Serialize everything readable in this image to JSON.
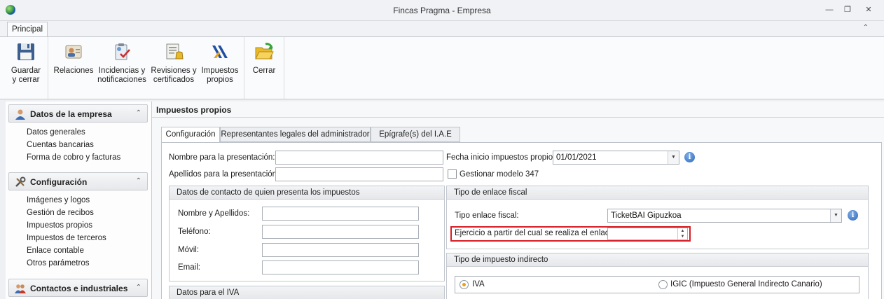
{
  "window": {
    "title": "Fincas Pragma - Empresa"
  },
  "ribbon": {
    "tab": "Principal",
    "buttons": [
      {
        "line1": "Guardar",
        "line2": "y cerrar",
        "icon": "floppy-disk-icon"
      },
      {
        "line1": "Relaciones",
        "line2": "",
        "icon": "contacts-icon"
      },
      {
        "line1": "Incidencias y",
        "line2": "notificaciones",
        "icon": "clipboard-icon"
      },
      {
        "line1": "Revisiones y",
        "line2": "certificados",
        "icon": "certificate-bell-icon"
      },
      {
        "line1": "Impuestos",
        "line2": "propios",
        "icon": "tax-agency-icon"
      },
      {
        "line1": "Cerrar",
        "line2": "",
        "icon": "open-folder-icon"
      }
    ]
  },
  "sidebar": {
    "groups": [
      {
        "label": "Datos de la empresa",
        "items": [
          "Datos generales",
          "Cuentas bancarias",
          "Forma de cobro y facturas"
        ]
      },
      {
        "label": "Configuración",
        "items": [
          "Imágenes y logos",
          "Gestión de recibos",
          "Impuestos propios",
          "Impuestos de terceros",
          "Enlace contable",
          "Otros parámetros"
        ]
      },
      {
        "label": "Contactos e industriales",
        "items": []
      }
    ]
  },
  "main": {
    "title": "Impuestos propios",
    "tabs": [
      "Configuración",
      "Representantes legales del administrador",
      "Epígrafe(s) del I.A.E"
    ],
    "form": {
      "nombre_presentacion_label": "Nombre para la presentación:",
      "nombre_presentacion_value": "",
      "apellidos_presentacion_label": "Apellidos para la presentación:",
      "apellidos_presentacion_value": "",
      "fecha_inicio_label": "Fecha inicio impuestos propios:",
      "fecha_inicio_value": "01/01/2021",
      "gestionar_347_label": "Gestionar modelo 347",
      "gestionar_347_checked": false
    },
    "contacto": {
      "header": "Datos de contacto de quien presenta los impuestos",
      "nombre_label": "Nombre y Apellidos:",
      "telefono_label": "Teléfono:",
      "movil_label": "Móvil:",
      "email_label": "Email:"
    },
    "iva_box": {
      "header": "Datos para el IVA"
    },
    "enlace_fiscal": {
      "header": "Tipo de enlace fiscal",
      "tipo_label": "Tipo enlace fiscal:",
      "tipo_value": "TicketBAI Gipuzkoa",
      "ejercicio_label": "Ejercicio a partir del cual se realiza el enlace:",
      "ejercicio_value": ""
    },
    "impuesto_indirecto": {
      "header": "Tipo de impuesto indirecto",
      "option_iva": "IVA",
      "option_igic": "IGIC (Impuesto General Indirecto Canario)",
      "selected": "IVA"
    }
  }
}
